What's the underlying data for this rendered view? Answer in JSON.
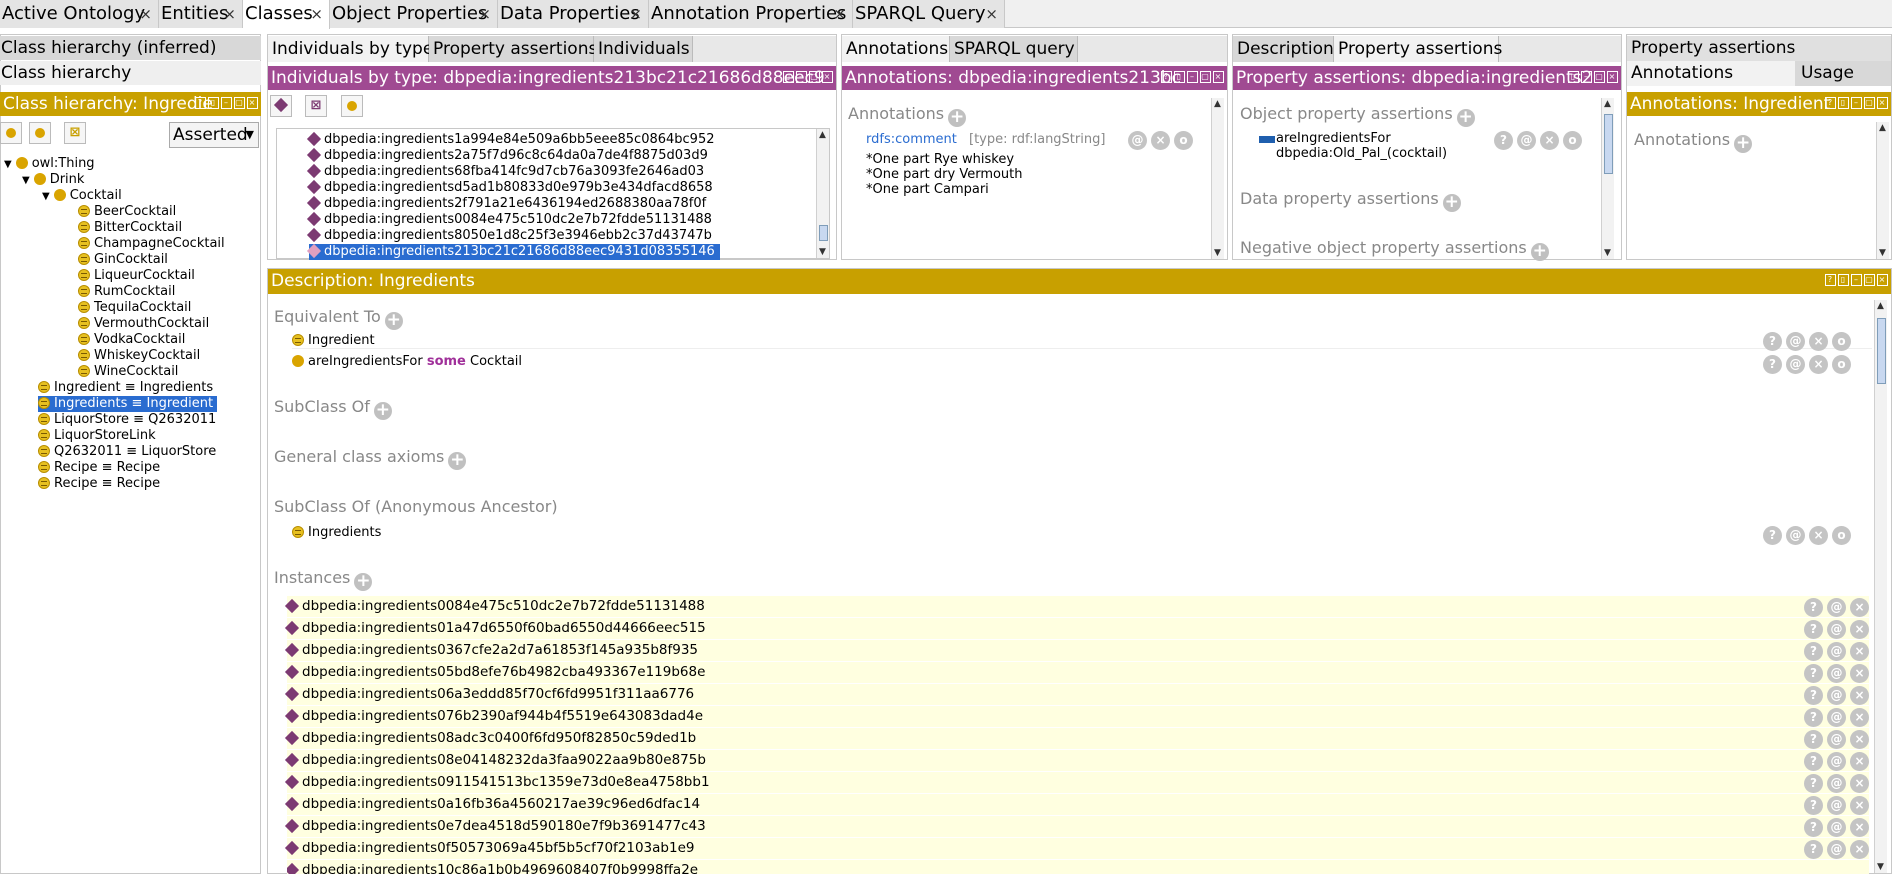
{
  "top_tabs": [
    {
      "label": "Active Ontology"
    },
    {
      "label": "Entities"
    },
    {
      "label": "Classes"
    },
    {
      "label": "Object Properties"
    },
    {
      "label": "Data Properties"
    },
    {
      "label": "Annotation Properties"
    },
    {
      "label": "SPARQL Query"
    }
  ],
  "close_glyph": "×",
  "left": {
    "tab_inferred": "Class hierarchy (inferred)",
    "tab_hierarchy": "Class hierarchy",
    "title": "Class hierarchy: Ingredie",
    "mode": "Asserted",
    "tree": [
      {
        "label": "owl:Thing"
      },
      {
        "label": "Drink"
      },
      {
        "label": "Cocktail"
      },
      {
        "label": "BeerCocktail"
      },
      {
        "label": "BitterCocktail"
      },
      {
        "label": "ChampagneCocktail"
      },
      {
        "label": "GinCocktail"
      },
      {
        "label": "LiqueurCocktail"
      },
      {
        "label": "RumCocktail"
      },
      {
        "label": "TequilaCocktail"
      },
      {
        "label": "VermouthCocktail"
      },
      {
        "label": "VodkaCocktail"
      },
      {
        "label": "WhiskeyCocktail"
      },
      {
        "label": "WineCocktail"
      },
      {
        "label": "Ingredient ≡ Ingredients"
      },
      {
        "label": "Ingredients ≡ Ingredient"
      },
      {
        "label": "LiquorStore ≡ Q2632011"
      },
      {
        "label": "LiquorStoreLink"
      },
      {
        "label": "Q2632011 ≡ LiquorStore"
      },
      {
        "label": "Recipe ≡ Recipe"
      },
      {
        "label": "Recipe ≡ Recipe"
      }
    ]
  },
  "individuals": {
    "tabs": [
      "Individuals by type",
      "Property assertions",
      "Individuals"
    ],
    "title": "Individuals by type: dbpedia:ingredients213bc21c21686d88eec9",
    "items": [
      "dbpedia:ingredients1a994e84e509a6bb5eee85c0864bc952",
      "dbpedia:ingredients2a75f7d96c8c64da0a7de4f8875d03d9",
      "dbpedia:ingredients68fba414fc9d7cb76a3093fe2646ad03",
      "dbpedia:ingredientsd5ad1b80833d0e979b3e434dfacd8658",
      "dbpedia:ingredients2f791a21e6436194ed2688380aa78f0f",
      "dbpedia:ingredients0084e475c510dc2e7b72fdde51131488",
      "dbpedia:ingredients8050e1d8c25f3e3946ebb2c37d43747b",
      "dbpedia:ingredients213bc21c21686d88eec9431d08355146"
    ]
  },
  "annotations": {
    "tabs": [
      "Annotations",
      "SPARQL query"
    ],
    "title": "Annotations: dbpedia:ingredients213bc",
    "section": "Annotations",
    "prop": "rdfs:comment",
    "type": "[type: rdf:langString]",
    "lines": [
      "*One part Rye whiskey",
      "*One part dry Vermouth",
      "*One part Campari"
    ]
  },
  "propassert": {
    "tabs": [
      "Description",
      "Property assertions"
    ],
    "title": "Property assertions: dbpedia:ingredients2",
    "obj_section": "Object property assertions",
    "obj_prop": "areIngredientsFor",
    "obj_value": "dbpedia:Old_Pal_(cocktail)",
    "data_section": "Data property assertions",
    "neg_section": "Negative object property assertions"
  },
  "right": {
    "tab1": "Property assertions",
    "tab2": "Annotations",
    "tab3": "Usage",
    "title": "Annotations: Ingredient",
    "section": "Annotations"
  },
  "description": {
    "title": "Description: Ingredients",
    "equiv_label": "Equivalent To",
    "equiv": [
      {
        "label": "Ingredient"
      },
      {
        "pre": "areIngredientsFor",
        "kw": "some",
        "post": "Cocktail"
      }
    ],
    "subclass_label": "SubClass Of",
    "gca_label": "General class axioms",
    "anon_label": "SubClass Of (Anonymous Ancestor)",
    "anon": [
      "Ingredients"
    ],
    "instances_label": "Instances",
    "instances": [
      "dbpedia:ingredients0084e475c510dc2e7b72fdde51131488",
      "dbpedia:ingredients01a47d6550f60bad6550d44666eec515",
      "dbpedia:ingredients0367cfe2a2d7a61853f145a935b8f935",
      "dbpedia:ingredients05bd8efe76b4982cba493367e119b68e",
      "dbpedia:ingredients06a3eddd85f70cf6fd9951f311aa6776",
      "dbpedia:ingredients076b2390af944b4f5519e643083dad4e",
      "dbpedia:ingredients08adc3c0400f6fd950f82850c59ded1b",
      "dbpedia:ingredients08e04148232da3faa9022aa9b80e875b",
      "dbpedia:ingredients0911541513bc1359e73d0e8ea4758bb1",
      "dbpedia:ingredients0a16fb36a4560217ae39c96ed6dfac14",
      "dbpedia:ingredients0e7dea4518d590180e7f9b3691477c43",
      "dbpedia:ingredients0f50573069a45bf5b5cf70f2103ab1e9",
      "dbpedia:ingredients10c86a1b0b4969608407f0b9998ffa2e"
    ]
  },
  "btn": {
    "help": "?",
    "at": "@",
    "del": "×",
    "edit": "o",
    "plus": "+"
  },
  "colors": {
    "purple_title": "#a04a92",
    "gold_title": "#c8a000",
    "selection": "#2a6cd0",
    "instance_bg": "#ffffe0"
  }
}
